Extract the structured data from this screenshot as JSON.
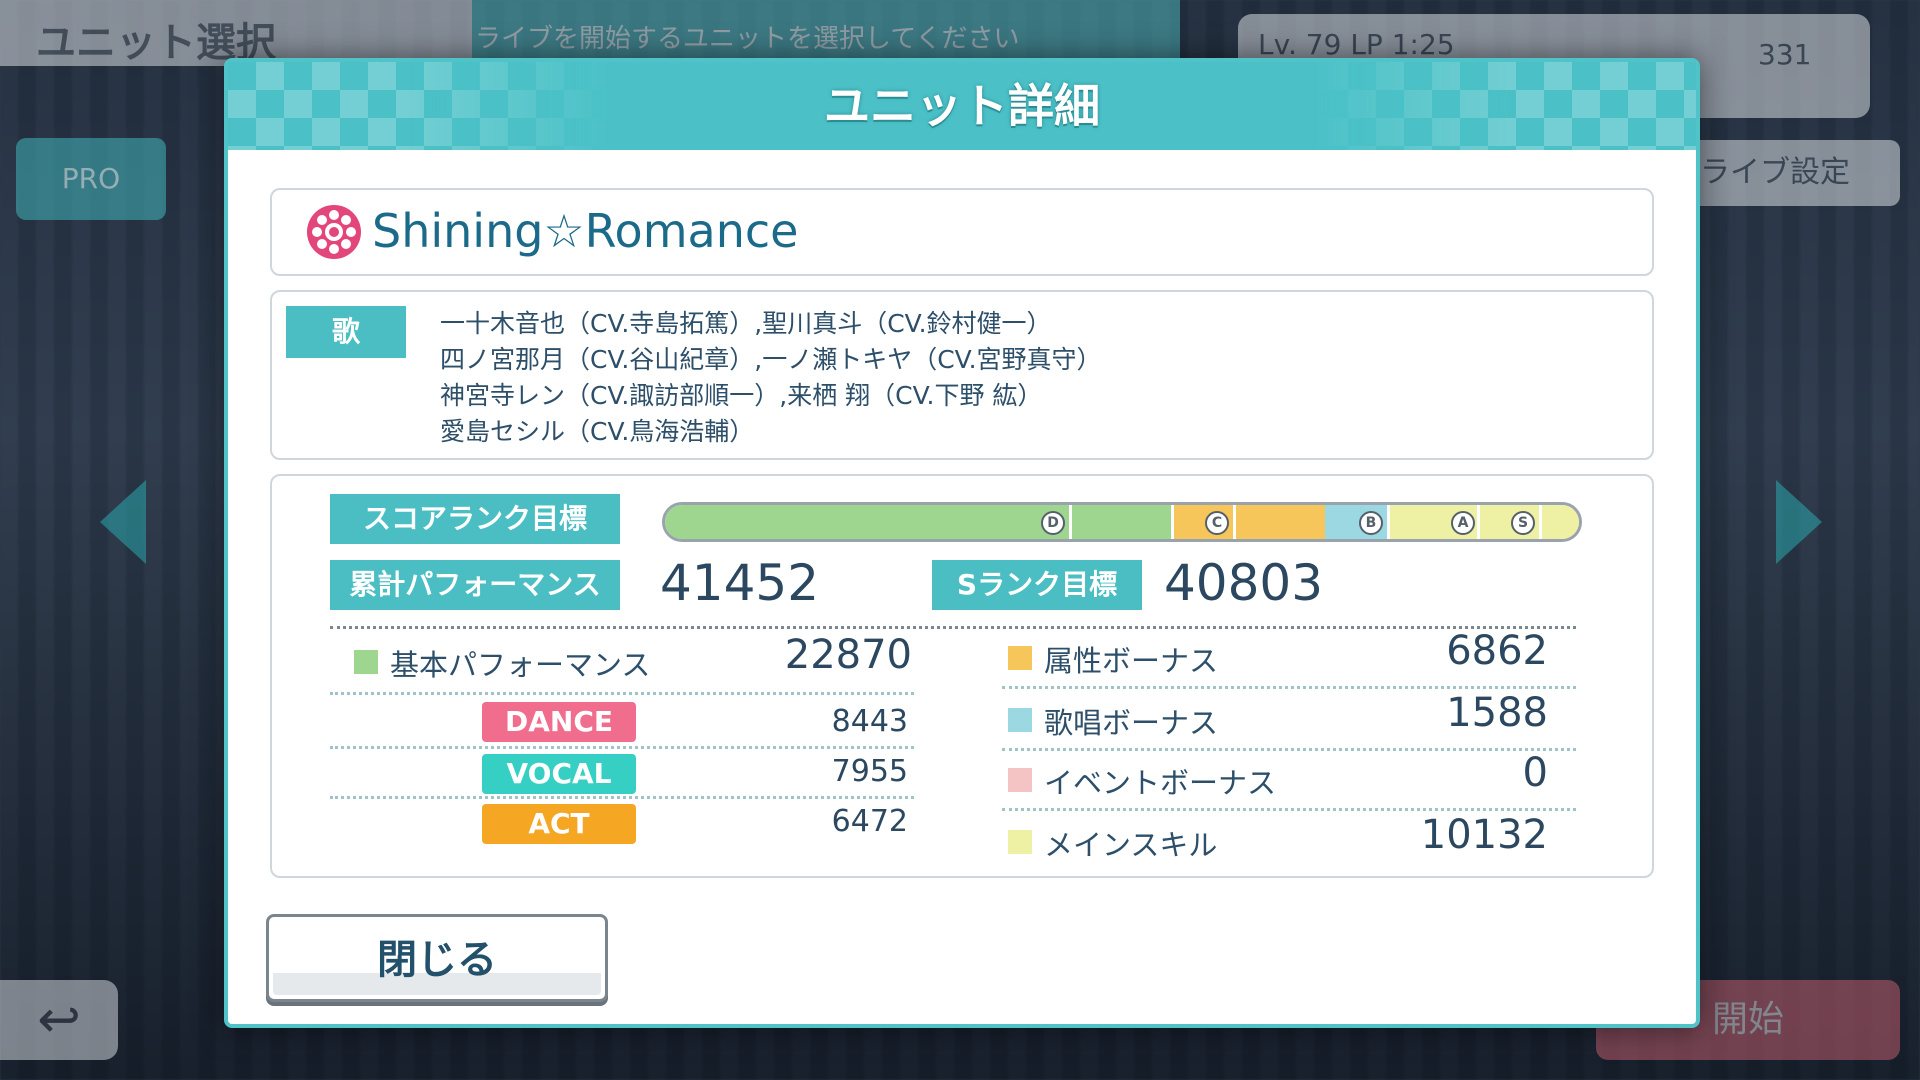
{
  "background": {
    "screen_title": "ユニット選択",
    "instruction": "ライブを開始するユニットを選択してください",
    "status": "Lv. 79   LP   1:25",
    "gems": "331",
    "difficulty": "PRO",
    "live_settings": "ライブ設定",
    "back_glyph": "↩",
    "start": "開始"
  },
  "dialog": {
    "title": "ユニット詳細",
    "unit_name": "Shining☆Romance",
    "song_tag": "歌",
    "singers": [
      "一十木音也（CV.寺島拓篤）,聖川真斗（CV.鈴村健一）",
      "四ノ宮那月（CV.谷山紀章）,一ノ瀬トキヤ（CV.宮野真守）",
      "神宮寺レン（CV.諏訪部順一）,来栖 翔（CV.下野 紘）",
      "愛島セシル（CV.鳥海浩輔）"
    ],
    "score_rank_label": "スコアランク目標",
    "rank_marks": [
      "D",
      "C",
      "B",
      "A",
      "S"
    ],
    "total_label": "累計パフォーマンス",
    "total_value": "41452",
    "s_rank_label": "Sランク目標",
    "s_rank_value": "40803",
    "left_stats": {
      "base_label": "基本パフォーマンス",
      "base_value": "22870",
      "dance_label": "DANCE",
      "dance_value": "8443",
      "vocal_label": "VOCAL",
      "vocal_value": "7955",
      "act_label": "ACT",
      "act_value": "6472"
    },
    "right_stats": [
      {
        "label": "属性ボーナス",
        "value": "6862",
        "color": "#f6c65a"
      },
      {
        "label": "歌唱ボーナス",
        "value": "1588",
        "color": "#9bd8e2"
      },
      {
        "label": "イベントボーナス",
        "value": "0",
        "color": "#f4c3c3"
      },
      {
        "label": "メインスキル",
        "value": "10132",
        "color": "#eef0a3"
      }
    ],
    "close_label": "閉じる"
  },
  "colors": {
    "accent": "#4bbec4",
    "base_perf": "#9fd68f",
    "dance": "#f06d8e",
    "vocal": "#35cfc4",
    "act": "#f5a623"
  }
}
